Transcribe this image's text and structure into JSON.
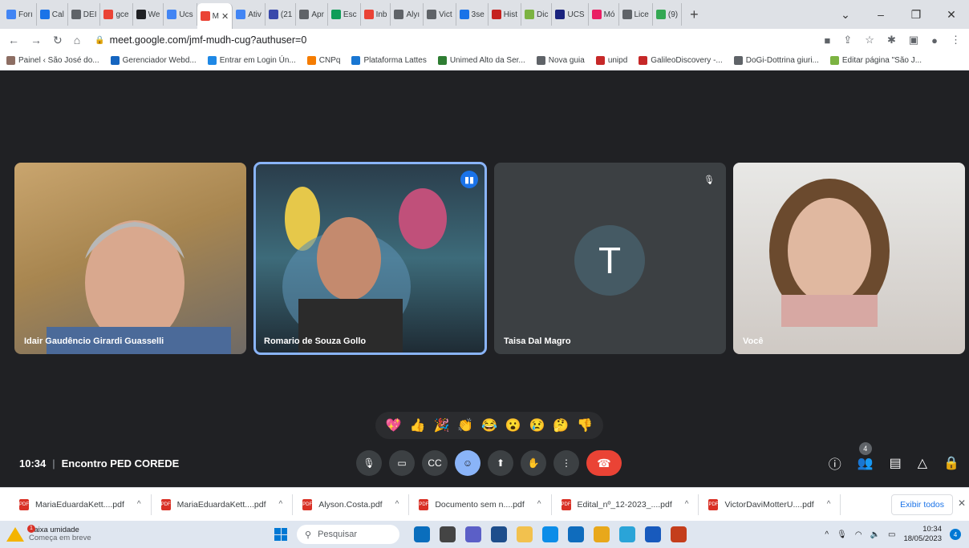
{
  "browser": {
    "tabs": [
      {
        "label": "Forı",
        "color": "#4285f4"
      },
      {
        "label": "Cal",
        "color": "#1a73e8"
      },
      {
        "label": "DEI",
        "color": "#5f6368"
      },
      {
        "label": "gce",
        "color": "#ea4335"
      },
      {
        "label": "We",
        "color": "#202124"
      },
      {
        "label": "Ucs",
        "color": "#4285f4"
      },
      {
        "label": "M",
        "color": "#ea4335",
        "active": true
      },
      {
        "label": "Ativ",
        "color": "#4285f4"
      },
      {
        "label": "(21",
        "color": "#3949ab"
      },
      {
        "label": "Apr",
        "color": "#5f6368"
      },
      {
        "label": "Esc",
        "color": "#0f9d58"
      },
      {
        "label": "Inb",
        "color": "#ea4335"
      },
      {
        "label": "Alyı",
        "color": "#5f6368"
      },
      {
        "label": "Vict",
        "color": "#5f6368"
      },
      {
        "label": "3se",
        "color": "#1a73e8"
      },
      {
        "label": "Hist",
        "color": "#c5221f"
      },
      {
        "label": "Dic",
        "color": "#7cb342"
      },
      {
        "label": "UCS",
        "color": "#1a237e"
      },
      {
        "label": "Mó",
        "color": "#e91e63"
      },
      {
        "label": "Lice",
        "color": "#5f6368"
      },
      {
        "label": "(9)",
        "color": "#34a853"
      }
    ],
    "address": "meet.google.com/jmf-mudh-cug?authuser=0",
    "bookmarks": [
      "Painel ‹ São José do...",
      "Gerenciador Webd...",
      "Entrar em Login Ún...",
      "CNPq",
      "Plataforma Lattes",
      "Unimed Alto da Ser...",
      "Nova guia",
      "unipd",
      "GalileoDiscovery -...",
      "DoGi-Dottrina giuri...",
      "Editar página \"São J..."
    ]
  },
  "meet": {
    "participants": [
      {
        "name": "Idair Gaudêncio Girardi Guasselli"
      },
      {
        "name": "Romario de Souza Gollo"
      },
      {
        "name": "Taisa Dal Magro",
        "initial": "T"
      },
      {
        "name": "Você"
      }
    ],
    "reactions": [
      "💖",
      "👍",
      "🎉",
      "👏",
      "😂",
      "😮",
      "😢",
      "🤔",
      "👎"
    ],
    "time": "10:34",
    "meeting_name": "Encontro PED COREDE",
    "participant_count": "4"
  },
  "downloads": {
    "items": [
      "MariaEduardaKett....pdf",
      "MariaEduardaKett....pdf",
      "Alyson.Costa.pdf",
      "Documento sem n....pdf",
      "Edital_nº_12-2023_....pdf",
      "VictorDaviMotterU....pdf"
    ],
    "show_all": "Exibir todos"
  },
  "taskbar": {
    "weather_title": "Baixa umidade",
    "weather_sub": "Começa em breve",
    "weather_badge": "1",
    "search_placeholder": "Pesquisar",
    "time": "10:34",
    "date": "18/05/2023",
    "notifications": "4"
  }
}
